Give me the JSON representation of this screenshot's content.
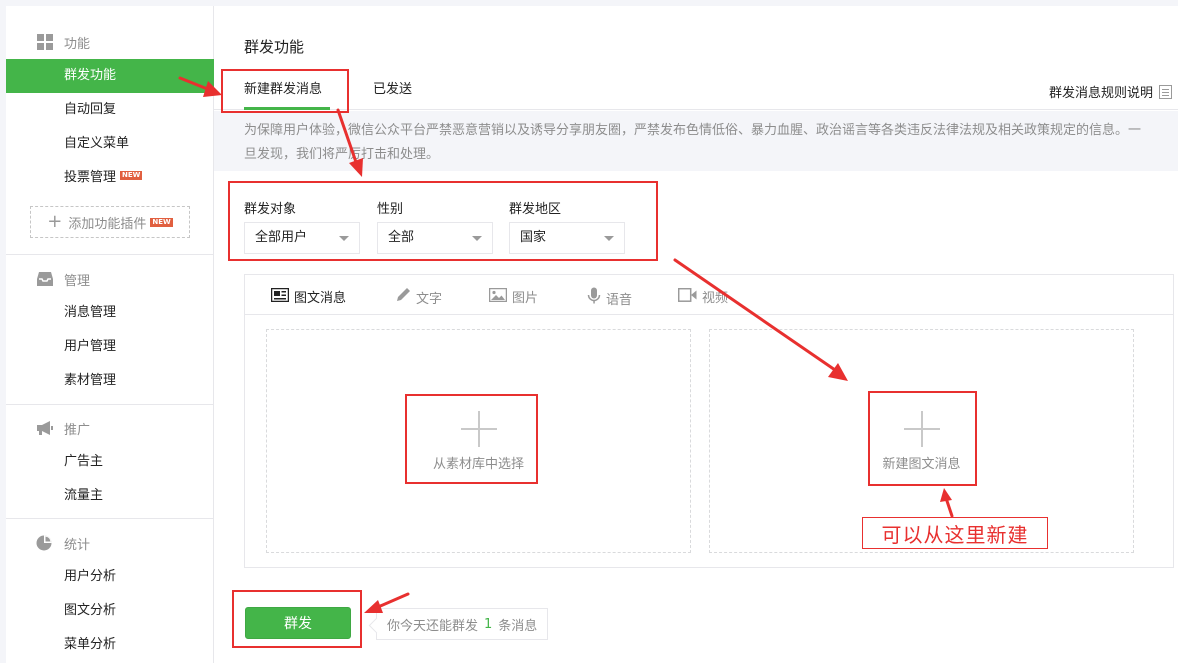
{
  "sidebar": {
    "sections": [
      {
        "title": "功能",
        "icon": "grid-icon",
        "items": [
          {
            "label": "群发功能",
            "active": true
          },
          {
            "label": "自动回复"
          },
          {
            "label": "自定义菜单"
          },
          {
            "label": "投票管理",
            "badge": "NEW"
          }
        ],
        "add_plugin": {
          "label": "添加功能插件",
          "badge": "NEW"
        }
      },
      {
        "title": "管理",
        "icon": "inbox-icon",
        "items": [
          {
            "label": "消息管理"
          },
          {
            "label": "用户管理"
          },
          {
            "label": "素材管理"
          }
        ]
      },
      {
        "title": "推广",
        "icon": "megaphone-icon",
        "items": [
          {
            "label": "广告主"
          },
          {
            "label": "流量主"
          }
        ]
      },
      {
        "title": "统计",
        "icon": "pie-chart-icon",
        "items": [
          {
            "label": "用户分析"
          },
          {
            "label": "图文分析"
          },
          {
            "label": "菜单分析"
          }
        ]
      }
    ]
  },
  "main": {
    "title": "群发功能",
    "tabs": [
      {
        "label": "新建群发消息",
        "active": true
      },
      {
        "label": "已发送"
      }
    ],
    "rule_link": "群发消息规则说明",
    "notice": "为保障用户体验，微信公众平台严禁恶意营销以及诱导分享朋友圈，严禁发布色情低俗、暴力血腥、政治谣言等各类违反法律法规及相关政策规定的信息。一旦发现，我们将严厉打击和处理。",
    "filters": [
      {
        "label": "群发对象",
        "value": "全部用户"
      },
      {
        "label": "性别",
        "value": "全部"
      },
      {
        "label": "群发地区",
        "value": "国家"
      }
    ],
    "editor_tabs": [
      {
        "label": "图文消息",
        "icon": "article-icon",
        "active": true
      },
      {
        "label": "文字",
        "icon": "pen-icon"
      },
      {
        "label": "图片",
        "icon": "image-icon"
      },
      {
        "label": "语音",
        "icon": "microphone-icon"
      },
      {
        "label": "视频",
        "icon": "video-icon"
      }
    ],
    "slots": {
      "library": "从素材库中选择",
      "create": "新建图文消息"
    },
    "send_button": "群发",
    "quota": {
      "prefix": "你今天还能群发",
      "count": "1",
      "suffix": "条消息"
    }
  },
  "annotation": {
    "note": "可以从这里新建",
    "color": "#e8302f"
  },
  "colors": {
    "accent": "#44b549",
    "annotation": "#e8302f"
  }
}
